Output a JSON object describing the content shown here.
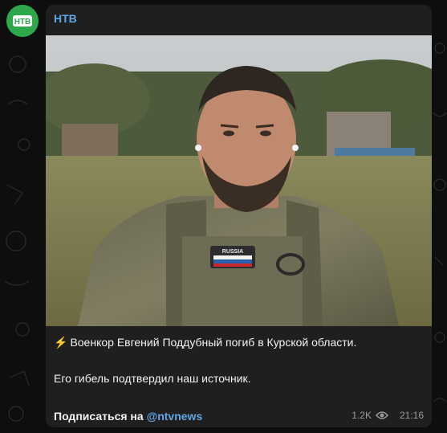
{
  "channel": {
    "name": "НТВ",
    "avatar_text": "НТВ",
    "brand_color": "#2ea84a"
  },
  "post": {
    "image": {
      "patch_text": "RUSSIA",
      "description_icon": "photo"
    },
    "caption": {
      "line1_icon": "⚡",
      "line1_text": "Военкор Евгений Поддубный погиб в Курской области.",
      "line2_text": "Его гибель подтвердил наш источник.",
      "subscribe_text": "Подписаться на",
      "subscribe_link": "@ntvnews"
    },
    "meta": {
      "views": "1.2K",
      "time": "21:16",
      "views_icon": "eye-icon"
    }
  },
  "colors": {
    "background": "#0e0e0e",
    "bubble": "#1f1f1f",
    "accent": "#5fa8e6"
  }
}
